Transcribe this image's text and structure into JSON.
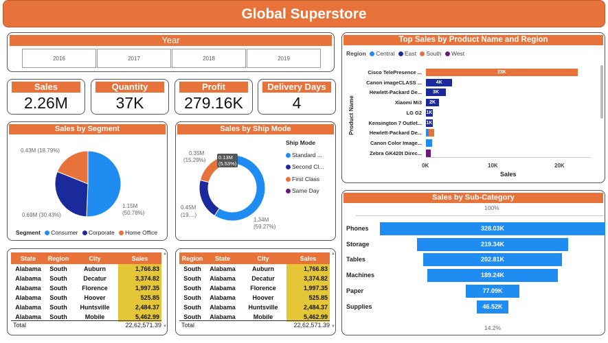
{
  "title": "Global Superstore",
  "year": {
    "title": "Year",
    "options": [
      "2016",
      "2017",
      "2018",
      "2019"
    ]
  },
  "kpis": {
    "sales": {
      "label": "Sales",
      "value": "2.26M"
    },
    "quantity": {
      "label": "Quantity",
      "value": "37K"
    },
    "profit": {
      "label": "Profit",
      "value": "279.16K"
    },
    "delivery": {
      "label": "Delivery Days",
      "value": "4"
    }
  },
  "segment": {
    "title": "Sales by Segment",
    "legend_title": "Segment",
    "labels": [
      "0.43M (18.79%)",
      "0.69M (30.43%)",
      "1.15M",
      "(50.78%)"
    ]
  },
  "shipmode": {
    "title": "Sales by Ship Mode",
    "legend_title": "Ship Mode",
    "labels": [
      "0.35M",
      "(15.29%)",
      "0.13M",
      "(5.53%)",
      "0.45M",
      "(19....)",
      "1.34M",
      "(59.27%)"
    ]
  },
  "top_sales": {
    "title": "Top Sales by Product Name and Region",
    "region_label": "Region",
    "y_label": "Product Name",
    "x_label": "Sales",
    "x_ticks": [
      "0K",
      "10K",
      "20K"
    ]
  },
  "subcat": {
    "title": "Sales by Sub-Category",
    "top_pct": "100%",
    "bottom_pct": "14.2%"
  },
  "table1": {
    "headers": [
      "State",
      "Region",
      "City",
      "Sales"
    ],
    "rows": [
      [
        "Alabama",
        "South",
        "Auburn",
        "1,766.83"
      ],
      [
        "Alabama",
        "South",
        "Decatur",
        "3,374.82"
      ],
      [
        "Alabama",
        "South",
        "Florence",
        "1,997.35"
      ],
      [
        "Alabama",
        "South",
        "Hoover",
        "525.85"
      ],
      [
        "Alabama",
        "South",
        "Huntsville",
        "2,484.37"
      ],
      [
        "Alabama",
        "South",
        "Mobile",
        "5,462.99"
      ]
    ],
    "total_label": "Total",
    "total_value": "22,62,571.39"
  },
  "table2": {
    "headers": [
      "Region",
      "State",
      "City",
      "Sales"
    ],
    "rows": [
      [
        "South",
        "Alabama",
        "Auburn",
        "1,766.83"
      ],
      [
        "South",
        "Alabama",
        "Decatur",
        "3,374.82"
      ],
      [
        "South",
        "Alabama",
        "Florence",
        "1,997.35"
      ],
      [
        "South",
        "Alabama",
        "Hoover",
        "525.85"
      ],
      [
        "South",
        "Alabama",
        "Huntsville",
        "2,484.37"
      ],
      [
        "South",
        "Alabama",
        "Mobile",
        "5,462.99"
      ]
    ],
    "total_label": "Total",
    "total_value": "22,62,571.39"
  },
  "colors": {
    "accent": "#E8733A",
    "central": "#1E8CF0",
    "east": "#1A2A9A",
    "south": "#E8733A",
    "west": "#6B1A7A",
    "highlight": "#E5C637"
  },
  "chart_data": [
    {
      "type": "pie",
      "title": "Sales by Segment",
      "categories": [
        "Consumer",
        "Corporate",
        "Home Office"
      ],
      "values": [
        1.15,
        0.69,
        0.43
      ],
      "percent": [
        50.78,
        30.43,
        18.79
      ],
      "unit": "M",
      "legend": "bottom"
    },
    {
      "type": "pie",
      "title": "Sales by Ship Mode",
      "donut": true,
      "categories": [
        "Standard ...",
        "Second Cl...",
        "First Class",
        "Same Day"
      ],
      "values": [
        1.34,
        0.45,
        0.35,
        0.13
      ],
      "percent": [
        59.27,
        19.0,
        15.29,
        5.53
      ],
      "unit": "M",
      "legend": "right"
    },
    {
      "type": "bar",
      "orientation": "horizontal",
      "title": "Top Sales by Product Name and Region",
      "categories": [
        "Cisco TelePresence ...",
        "Canon imageCLASS ...",
        "Hewlett-Packard De...",
        "Xiaomi Mi3",
        "LG G2",
        "Kensington 7 Outlet...",
        "Hewlett-Packard De...",
        "Canon Color Image...",
        "Zebra GK420t Direc..."
      ],
      "region": [
        "South",
        "East",
        "East",
        "East",
        "East",
        "East",
        "South",
        "Central",
        "West"
      ],
      "series": [
        {
          "name": "Central",
          "values": [
            0,
            0,
            0,
            0,
            0,
            0,
            0.4,
            0.9,
            0
          ]
        },
        {
          "name": "East",
          "values": [
            0,
            4,
            3,
            2,
            1,
            1,
            0,
            0,
            0
          ]
        },
        {
          "name": "South",
          "values": [
            23,
            0,
            0,
            0,
            0,
            0,
            0.8,
            0,
            0
          ]
        },
        {
          "name": "West",
          "values": [
            0,
            0,
            0,
            0,
            0,
            0,
            0,
            0,
            0.7
          ]
        }
      ],
      "data_labels": [
        "23K",
        "4K",
        "3K",
        "2K",
        "1K",
        "1K",
        "",
        "",
        ""
      ],
      "xlabel": "Sales",
      "ylabel": "Product Name",
      "xlim": [
        0,
        25
      ],
      "unit": "K",
      "legend": "top"
    },
    {
      "type": "bar",
      "subtype": "funnel",
      "title": "Sales by Sub-Category",
      "categories": [
        "Phones",
        "Storage",
        "Tables",
        "Machines",
        "Paper",
        "Supplies"
      ],
      "values": [
        328.03,
        219.34,
        202.81,
        189.24,
        77.09,
        46.52
      ],
      "labels": [
        "328.03K",
        "219.34K",
        "202.81K",
        "189.24K",
        "77.09K",
        "46.52K"
      ],
      "unit": "K"
    }
  ]
}
